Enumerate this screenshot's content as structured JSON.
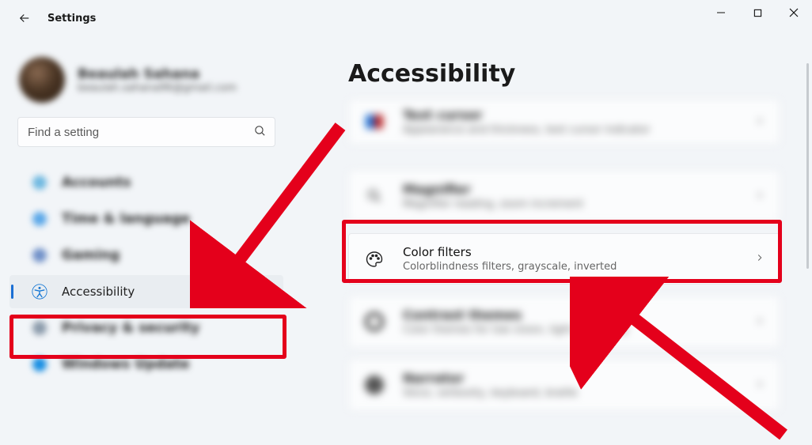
{
  "app_title": "Settings",
  "search": {
    "placeholder": "Find a setting"
  },
  "profile": {
    "name": "Beaulah Sahana",
    "email": "beaulah.sahana96@gmail.com"
  },
  "nav": {
    "accounts": "Accounts",
    "time": "Time & language",
    "gaming": "Gaming",
    "accessibility": "Accessibility",
    "privacy": "Privacy & security",
    "update": "Windows Update"
  },
  "page": {
    "title": "Accessibility",
    "cards": {
      "text_cursor": {
        "title": "Text cursor",
        "sub": "Appearance and thickness, text cursor indicator"
      },
      "magnifier": {
        "title": "Magnifier",
        "sub": "Magnifier reading, zoom increment"
      },
      "color_filters": {
        "title": "Color filters",
        "sub": "Colorblindness filters, grayscale, inverted"
      },
      "contrast": {
        "title": "Contrast themes",
        "sub": "Color themes for low vision, light sensitivity"
      },
      "narrator": {
        "title": "Narrator",
        "sub": "Voice, verbosity, keyboard, braille"
      }
    }
  }
}
